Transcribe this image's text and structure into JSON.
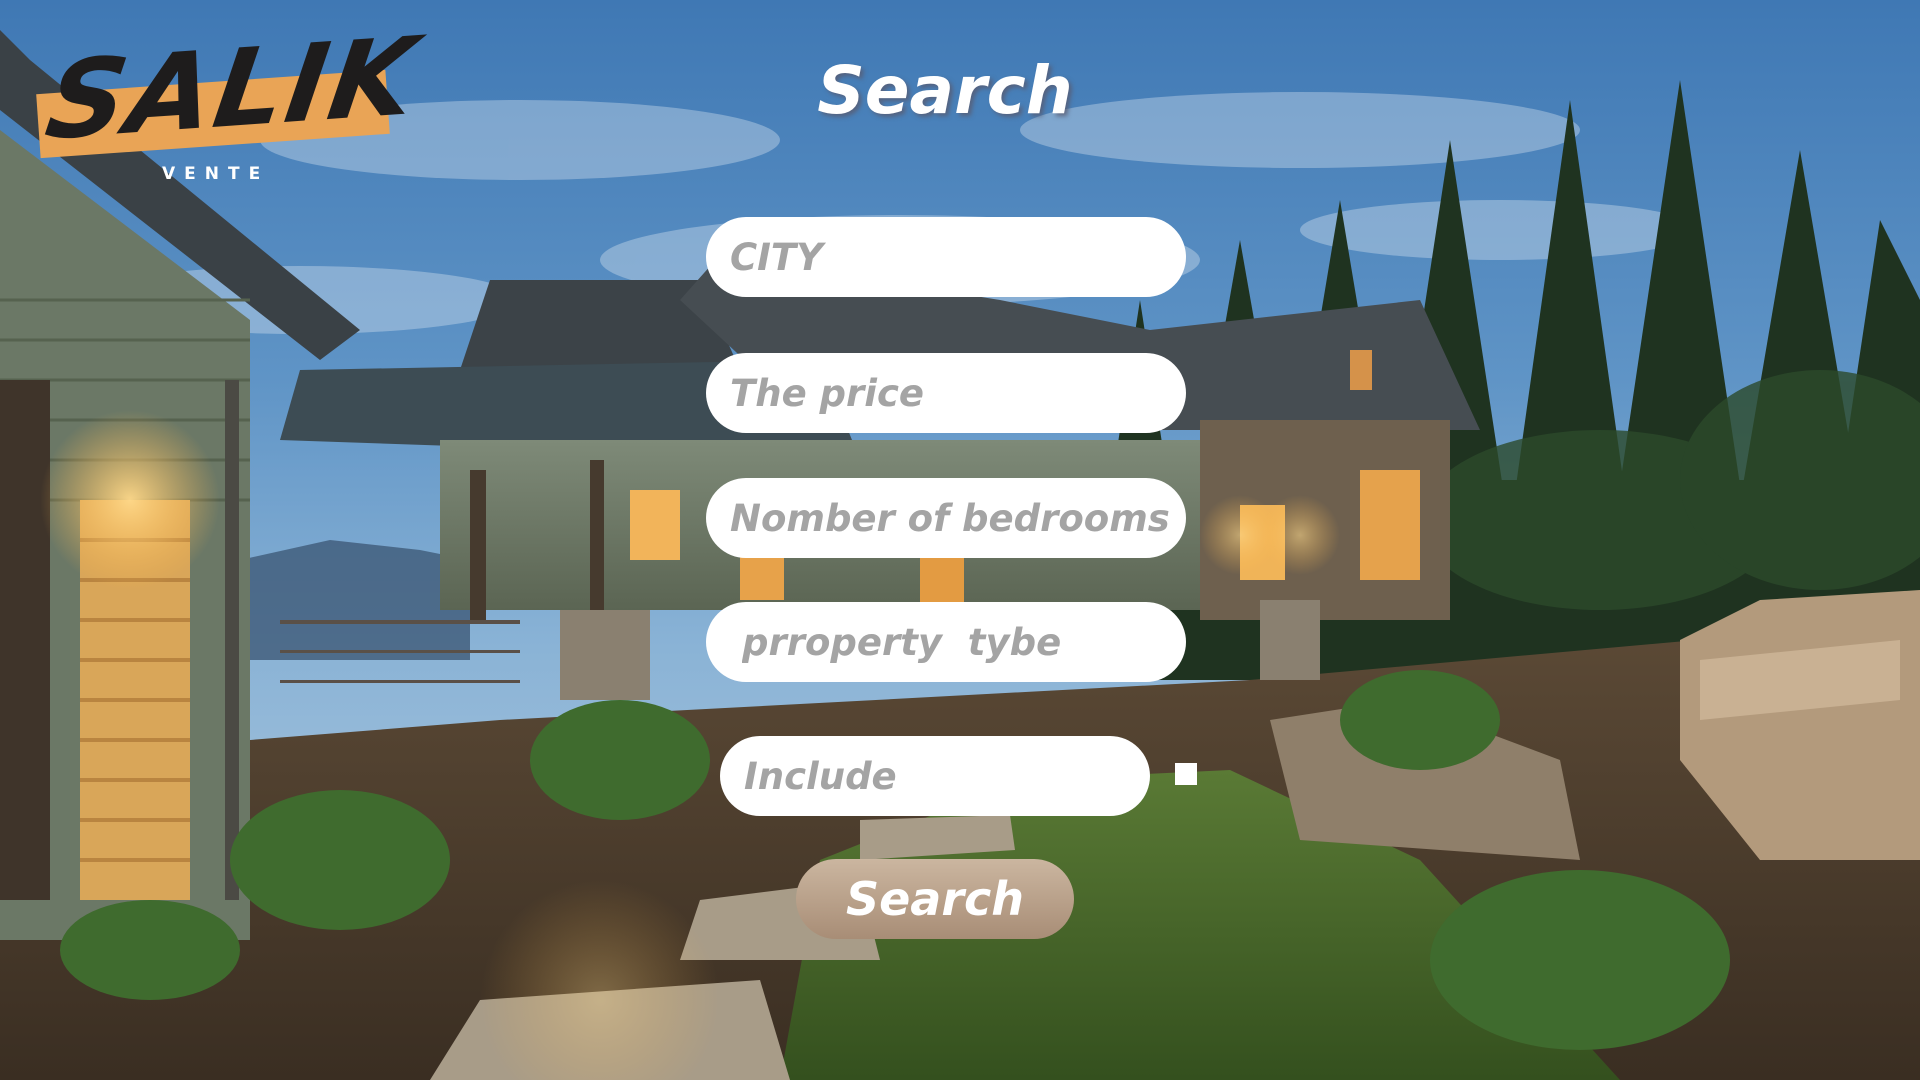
{
  "brand": {
    "logo_text": "SALIK",
    "logo_subtitle": "VENTE",
    "accent_color": "#e9a456"
  },
  "page": {
    "title": "Search",
    "background_image_description": "house-at-dusk"
  },
  "form": {
    "city_placeholder": "CITY",
    "price_placeholder": "The price",
    "bedrooms_placeholder": "Nomber of bedrooms",
    "property_type_placeholder": "prroperty  tybe",
    "include_placeholder": "Include",
    "include_checked": false,
    "search_label": "Search"
  },
  "icons": {
    "checkbox": "checkbox-icon"
  }
}
